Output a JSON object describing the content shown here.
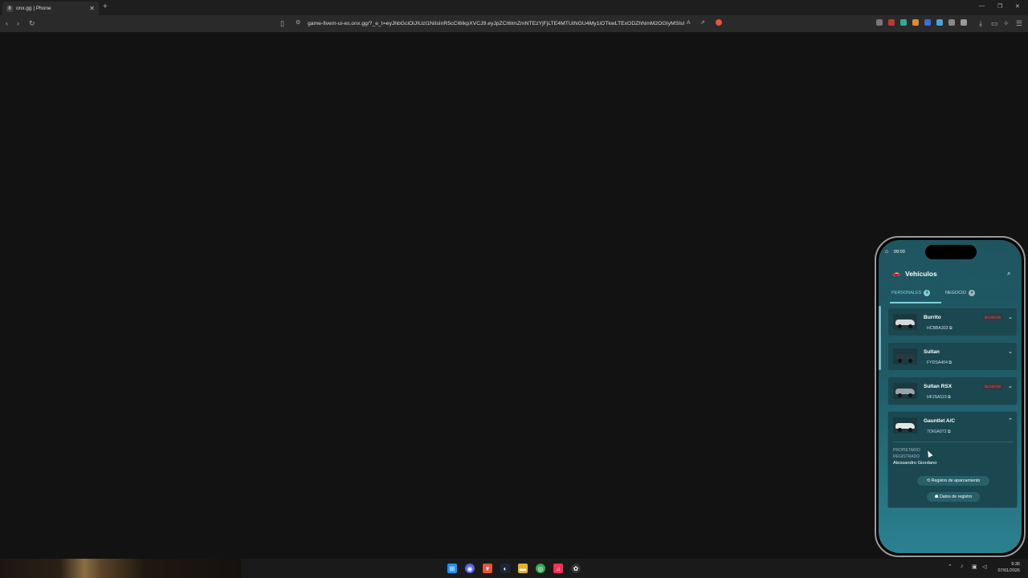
{
  "browser": {
    "tab_title": "onx.gg | Phone",
    "tab_favicon": "8",
    "new_tab_icon": "+",
    "url": "game-fivem-ui-es.onx.gg/?_e_t=eyJhbGciOiJIUzI1NiIsInR5cCI6IkpXVCJ9.eyJpZCI6ImZmNTEzYjFjLTE4MTUtNGU4My1iOTkwLTExODZhNmM2OGIyMSIsI..."
  },
  "phone": {
    "status_time": "09:00",
    "header_title": "Vehículos",
    "tabs": [
      {
        "label": "PERSONALES",
        "count": "4"
      },
      {
        "label": "NEGOCIO",
        "count": "4"
      }
    ],
    "vehicles": [
      {
        "name": "Burrito",
        "plate": "HCBBA303 ⧉",
        "price": "$4,000.00",
        "car_color": "#d8d8d8",
        "chevron": "⌄"
      },
      {
        "name": "Sultan",
        "plate": "FYDSA404 ⧉",
        "price": "",
        "car_color": "#2b3a42",
        "chevron": "⌄"
      },
      {
        "name": "Sultan RSX",
        "plate": "HFJSA119 ⧉",
        "price": "$2,000.00",
        "car_color": "#9aa3a8",
        "chevron": "⌄"
      },
      {
        "name": "Gauntlet A/C",
        "plate": "7OIGA072 ⧉",
        "price": "",
        "car_color": "#e6e6e6",
        "chevron": "⌃"
      }
    ],
    "expanded": {
      "owner_label": "PROPIETARIO REGISTRADO",
      "owner_name": "Alessandro Giordano",
      "parking_button": "⟲ Registro de aparcamiento",
      "registration_button": "☗ Datos de registro"
    }
  },
  "taskbar": {
    "time": "9:36",
    "date": "07/01/2026"
  }
}
